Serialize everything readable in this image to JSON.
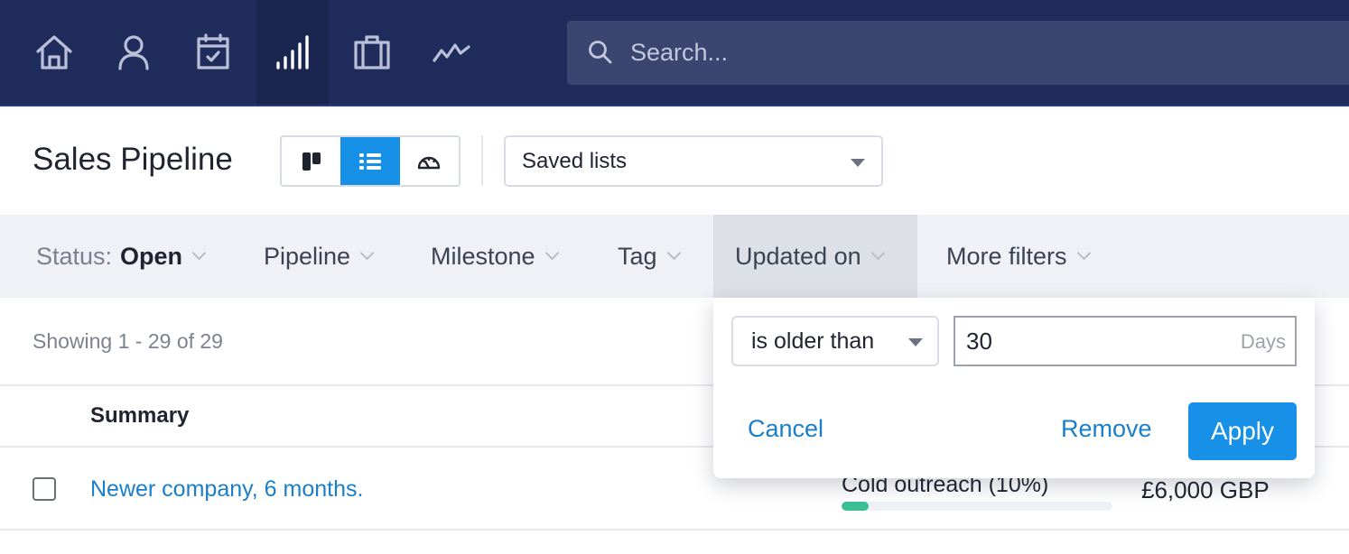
{
  "nav": {
    "items": [
      {
        "icon": "home-icon",
        "label": "Home",
        "active": false
      },
      {
        "icon": "person-icon",
        "label": "People",
        "active": false
      },
      {
        "icon": "calendar-check-icon",
        "label": "Tasks",
        "active": false
      },
      {
        "icon": "signal-bars-icon",
        "label": "Sales",
        "active": true
      },
      {
        "icon": "briefcase-icon",
        "label": "Cases",
        "active": false
      },
      {
        "icon": "activity-icon",
        "label": "Reports",
        "active": false
      }
    ],
    "search_placeholder": "Search..."
  },
  "header": {
    "title": "Sales Pipeline",
    "views": [
      {
        "icon": "board-view-icon",
        "active": false
      },
      {
        "icon": "list-view-icon",
        "active": true
      },
      {
        "icon": "dashboard-gauge-icon",
        "active": false
      }
    ],
    "saved_lists_label": "Saved lists"
  },
  "filters": {
    "status_label": "Status:",
    "status_value": "Open",
    "pipeline": "Pipeline",
    "milestone": "Milestone",
    "tag": "Tag",
    "updated_on": "Updated on",
    "more_filters": "More filters"
  },
  "popover": {
    "operator": "is older than",
    "value": "30",
    "unit": "Days",
    "cancel": "Cancel",
    "remove": "Remove",
    "apply": "Apply"
  },
  "list": {
    "showing": "Showing 1 - 29 of 29",
    "columns": {
      "summary": "Summary"
    },
    "rows": [
      {
        "summary": "Newer company, 6 months.",
        "milestone": "Cold outreach (10%)",
        "progress": 0.1,
        "amount": "£6,000 GBP",
        "checked": false
      }
    ]
  },
  "colors": {
    "nav_bg": "#202d5c",
    "accent": "#1790e8",
    "link": "#1a7fc8",
    "progress": "#3bbf95"
  }
}
